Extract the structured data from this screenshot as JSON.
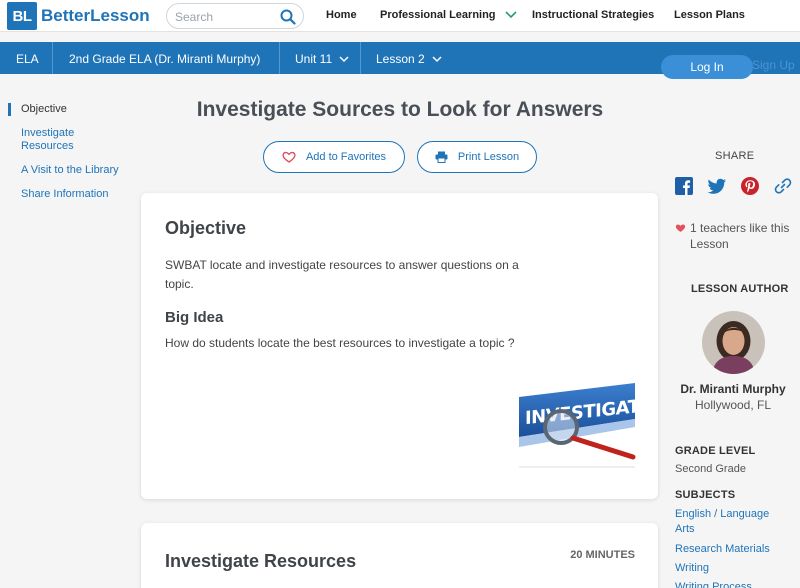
{
  "brand": {
    "logo_mark": "BL",
    "name": "BetterLesson",
    "accent": "#1f74b8"
  },
  "search": {
    "placeholder": "Search",
    "icon": "search-icon"
  },
  "topnav": {
    "home": "Home",
    "professional_learning": "Professional Learning",
    "instructional_strategies": "Instructional Strategies",
    "lesson_plans": "Lesson Plans"
  },
  "breadcrumb": {
    "subject": "ELA",
    "course": "2nd Grade ELA (Dr. Miranti Murphy)",
    "unit": "Unit 11",
    "lesson": "Lesson 2"
  },
  "auth": {
    "login": "Log In",
    "signup": "Sign Up"
  },
  "leftnav": {
    "items": [
      {
        "label": "Objective",
        "active": true
      },
      {
        "label": "Investigate Resources"
      },
      {
        "label": "A Visit to the Library"
      },
      {
        "label": "Share Information"
      }
    ]
  },
  "lesson": {
    "title": "Investigate Sources to Look for Answers",
    "favorite_label": "Add to Favorites",
    "print_label": "Print Lesson"
  },
  "objective_card": {
    "heading": "Objective",
    "objective_text": "SWBAT locate and investigate resources to answer questions on a topic.",
    "big_idea_heading": "Big Idea",
    "big_idea_text": "How do students locate the best resources to investigate a topic ?",
    "image_word": "INVESTIGATE"
  },
  "resources_card": {
    "heading": "Investigate Resources",
    "duration": "20 MINUTES"
  },
  "sidebar": {
    "share_label": "SHARE",
    "social": [
      "facebook-icon",
      "twitter-icon",
      "pinterest-icon",
      "link-icon"
    ],
    "likes_text": "1 teachers like this Lesson",
    "author_label": "LESSON AUTHOR",
    "author_name": "Dr. Miranti Murphy",
    "author_location": "Hollywood, FL",
    "grade_label": "GRADE LEVEL",
    "grade_value": "Second Grade",
    "subjects_label": "SUBJECTS",
    "subjects": [
      "English / Language Arts",
      "Research Materials",
      "Writing",
      "Writing Process"
    ]
  }
}
